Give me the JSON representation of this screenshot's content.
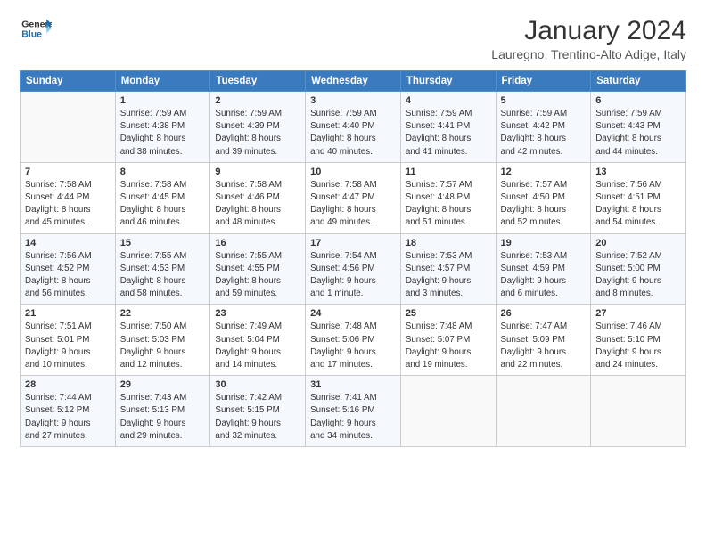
{
  "header": {
    "logo_line1": "General",
    "logo_line2": "Blue",
    "title": "January 2024",
    "subtitle": "Lauregno, Trentino-Alto Adige, Italy"
  },
  "columns": [
    "Sunday",
    "Monday",
    "Tuesday",
    "Wednesday",
    "Thursday",
    "Friday",
    "Saturday"
  ],
  "weeks": [
    [
      {
        "day": "",
        "info": ""
      },
      {
        "day": "1",
        "info": "Sunrise: 7:59 AM\nSunset: 4:38 PM\nDaylight: 8 hours\nand 38 minutes."
      },
      {
        "day": "2",
        "info": "Sunrise: 7:59 AM\nSunset: 4:39 PM\nDaylight: 8 hours\nand 39 minutes."
      },
      {
        "day": "3",
        "info": "Sunrise: 7:59 AM\nSunset: 4:40 PM\nDaylight: 8 hours\nand 40 minutes."
      },
      {
        "day": "4",
        "info": "Sunrise: 7:59 AM\nSunset: 4:41 PM\nDaylight: 8 hours\nand 41 minutes."
      },
      {
        "day": "5",
        "info": "Sunrise: 7:59 AM\nSunset: 4:42 PM\nDaylight: 8 hours\nand 42 minutes."
      },
      {
        "day": "6",
        "info": "Sunrise: 7:59 AM\nSunset: 4:43 PM\nDaylight: 8 hours\nand 44 minutes."
      }
    ],
    [
      {
        "day": "7",
        "info": "Sunrise: 7:58 AM\nSunset: 4:44 PM\nDaylight: 8 hours\nand 45 minutes."
      },
      {
        "day": "8",
        "info": "Sunrise: 7:58 AM\nSunset: 4:45 PM\nDaylight: 8 hours\nand 46 minutes."
      },
      {
        "day": "9",
        "info": "Sunrise: 7:58 AM\nSunset: 4:46 PM\nDaylight: 8 hours\nand 48 minutes."
      },
      {
        "day": "10",
        "info": "Sunrise: 7:58 AM\nSunset: 4:47 PM\nDaylight: 8 hours\nand 49 minutes."
      },
      {
        "day": "11",
        "info": "Sunrise: 7:57 AM\nSunset: 4:48 PM\nDaylight: 8 hours\nand 51 minutes."
      },
      {
        "day": "12",
        "info": "Sunrise: 7:57 AM\nSunset: 4:50 PM\nDaylight: 8 hours\nand 52 minutes."
      },
      {
        "day": "13",
        "info": "Sunrise: 7:56 AM\nSunset: 4:51 PM\nDaylight: 8 hours\nand 54 minutes."
      }
    ],
    [
      {
        "day": "14",
        "info": "Sunrise: 7:56 AM\nSunset: 4:52 PM\nDaylight: 8 hours\nand 56 minutes."
      },
      {
        "day": "15",
        "info": "Sunrise: 7:55 AM\nSunset: 4:53 PM\nDaylight: 8 hours\nand 58 minutes."
      },
      {
        "day": "16",
        "info": "Sunrise: 7:55 AM\nSunset: 4:55 PM\nDaylight: 8 hours\nand 59 minutes."
      },
      {
        "day": "17",
        "info": "Sunrise: 7:54 AM\nSunset: 4:56 PM\nDaylight: 9 hours\nand 1 minute."
      },
      {
        "day": "18",
        "info": "Sunrise: 7:53 AM\nSunset: 4:57 PM\nDaylight: 9 hours\nand 3 minutes."
      },
      {
        "day": "19",
        "info": "Sunrise: 7:53 AM\nSunset: 4:59 PM\nDaylight: 9 hours\nand 6 minutes."
      },
      {
        "day": "20",
        "info": "Sunrise: 7:52 AM\nSunset: 5:00 PM\nDaylight: 9 hours\nand 8 minutes."
      }
    ],
    [
      {
        "day": "21",
        "info": "Sunrise: 7:51 AM\nSunset: 5:01 PM\nDaylight: 9 hours\nand 10 minutes."
      },
      {
        "day": "22",
        "info": "Sunrise: 7:50 AM\nSunset: 5:03 PM\nDaylight: 9 hours\nand 12 minutes."
      },
      {
        "day": "23",
        "info": "Sunrise: 7:49 AM\nSunset: 5:04 PM\nDaylight: 9 hours\nand 14 minutes."
      },
      {
        "day": "24",
        "info": "Sunrise: 7:48 AM\nSunset: 5:06 PM\nDaylight: 9 hours\nand 17 minutes."
      },
      {
        "day": "25",
        "info": "Sunrise: 7:48 AM\nSunset: 5:07 PM\nDaylight: 9 hours\nand 19 minutes."
      },
      {
        "day": "26",
        "info": "Sunrise: 7:47 AM\nSunset: 5:09 PM\nDaylight: 9 hours\nand 22 minutes."
      },
      {
        "day": "27",
        "info": "Sunrise: 7:46 AM\nSunset: 5:10 PM\nDaylight: 9 hours\nand 24 minutes."
      }
    ],
    [
      {
        "day": "28",
        "info": "Sunrise: 7:44 AM\nSunset: 5:12 PM\nDaylight: 9 hours\nand 27 minutes."
      },
      {
        "day": "29",
        "info": "Sunrise: 7:43 AM\nSunset: 5:13 PM\nDaylight: 9 hours\nand 29 minutes."
      },
      {
        "day": "30",
        "info": "Sunrise: 7:42 AM\nSunset: 5:15 PM\nDaylight: 9 hours\nand 32 minutes."
      },
      {
        "day": "31",
        "info": "Sunrise: 7:41 AM\nSunset: 5:16 PM\nDaylight: 9 hours\nand 34 minutes."
      },
      {
        "day": "",
        "info": ""
      },
      {
        "day": "",
        "info": ""
      },
      {
        "day": "",
        "info": ""
      }
    ]
  ]
}
